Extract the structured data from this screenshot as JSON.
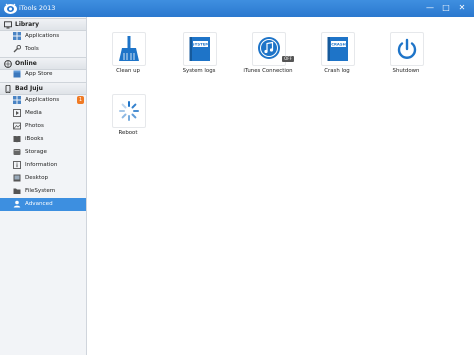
{
  "window": {
    "title": "iTools 2013",
    "controls": {
      "minimize": "—",
      "maximize": "□",
      "close": "✕"
    }
  },
  "sidebar": {
    "sections": [
      {
        "label": "Library",
        "icon": "monitor-icon",
        "items": [
          {
            "label": "Applications",
            "icon": "grid-icon"
          },
          {
            "label": "Tools",
            "icon": "wrench-icon"
          }
        ]
      },
      {
        "label": "Online",
        "icon": "globe-icon",
        "items": [
          {
            "label": "App Store",
            "icon": "store-icon"
          }
        ]
      },
      {
        "label": "Bad Juju",
        "icon": "phone-icon",
        "items": [
          {
            "label": "Applications",
            "icon": "grid-icon",
            "badge": "1"
          },
          {
            "label": "Media",
            "icon": "media-icon"
          },
          {
            "label": "Photos",
            "icon": "photo-icon"
          },
          {
            "label": "iBooks",
            "icon": "book-icon"
          },
          {
            "label": "Storage",
            "icon": "storage-icon"
          },
          {
            "label": "Information",
            "icon": "info-icon"
          },
          {
            "label": "Desktop",
            "icon": "desktop-icon"
          },
          {
            "label": "FileSystem",
            "icon": "folder-icon"
          },
          {
            "label": "Advanced",
            "icon": "user-icon",
            "active": true
          }
        ]
      }
    ]
  },
  "tools": [
    {
      "label": "Clean up",
      "icon": "broom-icon"
    },
    {
      "label": "System logs",
      "icon": "system-logs-icon",
      "icon_text": "SYSTEM"
    },
    {
      "label": "iTunes Connection",
      "icon": "itunes-icon",
      "status": "OFF"
    },
    {
      "label": "Crash log",
      "icon": "crash-log-icon",
      "icon_text": "CRASH"
    },
    {
      "label": "Shutdown",
      "icon": "power-icon"
    },
    {
      "label": "Reboot",
      "icon": "reboot-spinner-icon"
    }
  ],
  "colors": {
    "title_bar": "#2a78cf",
    "accent": "#3d8fe0",
    "badge": "#f07a24",
    "icon_blue": "#1e74c8"
  }
}
